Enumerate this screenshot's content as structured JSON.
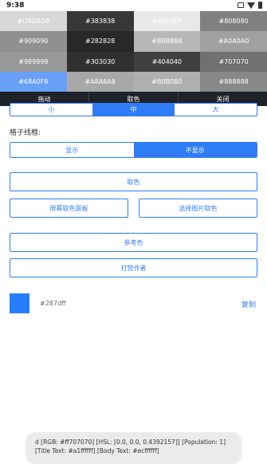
{
  "status_bar": {
    "time": "9:38"
  },
  "color_grid": [
    {
      "label": "#D8D8D8",
      "color": "#D8D8D8"
    },
    {
      "label": "#383838",
      "color": "#383838"
    },
    {
      "label": "#E8E8E8",
      "color": "#E8E8E8"
    },
    {
      "label": "#808080",
      "color": "#808080"
    },
    {
      "label": "#909090",
      "color": "#909090"
    },
    {
      "label": "#282828",
      "color": "#282828"
    },
    {
      "label": "#B8B8B8",
      "color": "#B8B8B8"
    },
    {
      "label": "#A0A0A0",
      "color": "#A0A0A0"
    },
    {
      "label": "#989898",
      "color": "#989898"
    },
    {
      "label": "#303030",
      "color": "#303030"
    },
    {
      "label": "#404040",
      "color": "#404040"
    },
    {
      "label": "#707070",
      "color": "#707070"
    },
    {
      "label": "#68A0F8",
      "color": "#68A0F8"
    },
    {
      "label": "#A8A8A8",
      "color": "#A8A8A8"
    },
    {
      "label": "#B0B0B0",
      "color": "#B0B0B0"
    },
    {
      "label": "#888888",
      "color": "#888888"
    }
  ],
  "panel_bar": {
    "drag": "拖动",
    "pick": "取色",
    "close": "关闭"
  },
  "size_options": [
    "小",
    "中",
    "大"
  ],
  "size_selected": "中",
  "grid_lines": {
    "label": "格子线框:",
    "show": "显示",
    "hide": "不显示",
    "selected": "不显示"
  },
  "buttons": {
    "pick_color": "取色",
    "screen_panel": "屏幕取色面板",
    "image_pick": "选择图片取色",
    "reference": "参考色",
    "donate": "打赏作者"
  },
  "current_color": {
    "hex": "#287dff",
    "swatch": "#287dff",
    "copy_label": "复制"
  },
  "toast": {
    "line1": "d [RGB: #ff707070] [HSL: [0.0, 0.0, 0.4392157]] [Population: 1]",
    "line2": "[Title Text: #a1ffffff] [Body Text: #ecffffff]"
  }
}
